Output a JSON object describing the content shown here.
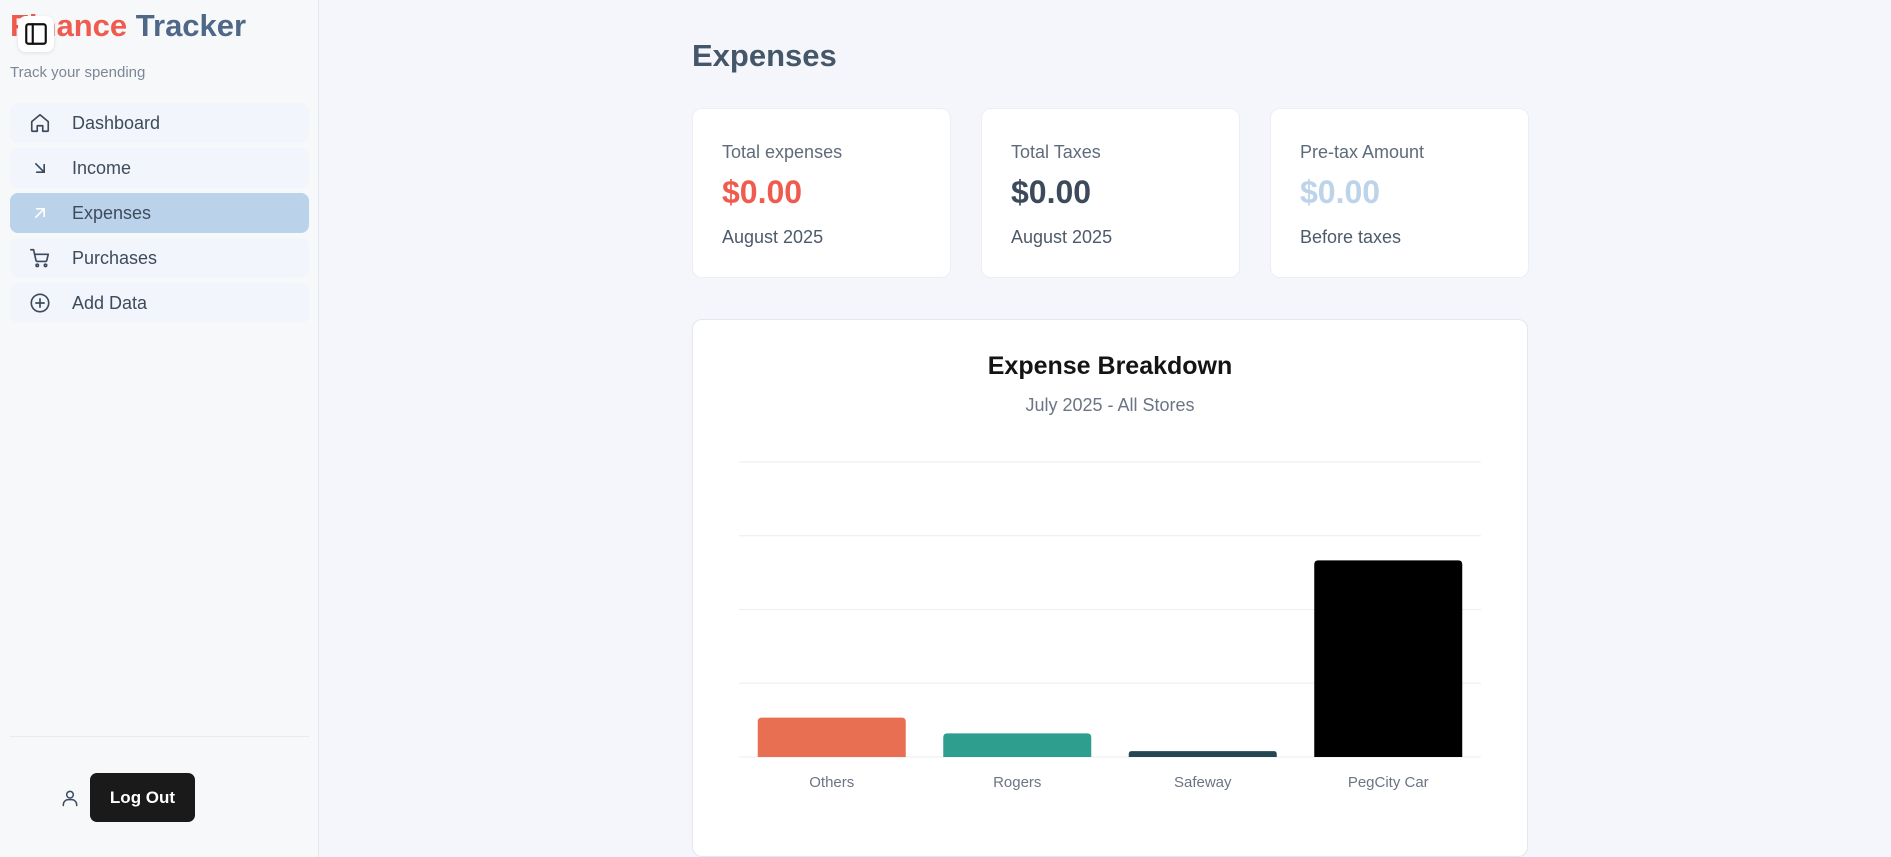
{
  "sidebar": {
    "brand_part1": "Finance",
    "brand_part2": "Tracker",
    "tagline": "Track your spending",
    "items": [
      {
        "label": "Dashboard",
        "icon": "home-icon"
      },
      {
        "label": "Income",
        "icon": "arrow-down-right-icon"
      },
      {
        "label": "Expenses",
        "icon": "arrow-up-right-icon",
        "active": true
      },
      {
        "label": "Purchases",
        "icon": "shopping-cart-icon"
      },
      {
        "label": "Add Data",
        "icon": "plus-circle-icon"
      }
    ],
    "logout_label": "Log Out"
  },
  "main": {
    "title": "Expenses",
    "cards": [
      {
        "label": "Total expenses",
        "value": "$0.00",
        "sub": "August 2025",
        "color": "#ef5b4e"
      },
      {
        "label": "Total Taxes",
        "value": "$0.00",
        "sub": "August 2025",
        "color": "#3d4a5c"
      },
      {
        "label": "Pre-tax Amount",
        "value": "$0.00",
        "sub": "Before taxes",
        "color": "#bcd3ea"
      }
    ]
  },
  "chart": {
    "title": "Expense Breakdown",
    "subtitle": "July 2025 - All Stores"
  },
  "chart_data": {
    "type": "bar",
    "categories": [
      "Others",
      "Rogers",
      "Safeway",
      "PegCity Car"
    ],
    "values": [
      40,
      24,
      6,
      200
    ],
    "colors": [
      "#e96f52",
      "#2e9e8f",
      "#264653",
      "#000000"
    ],
    "ylim": [
      0,
      300
    ],
    "grid": true,
    "title": "Expense Breakdown",
    "subtitle": "July 2025 - All Stores"
  }
}
